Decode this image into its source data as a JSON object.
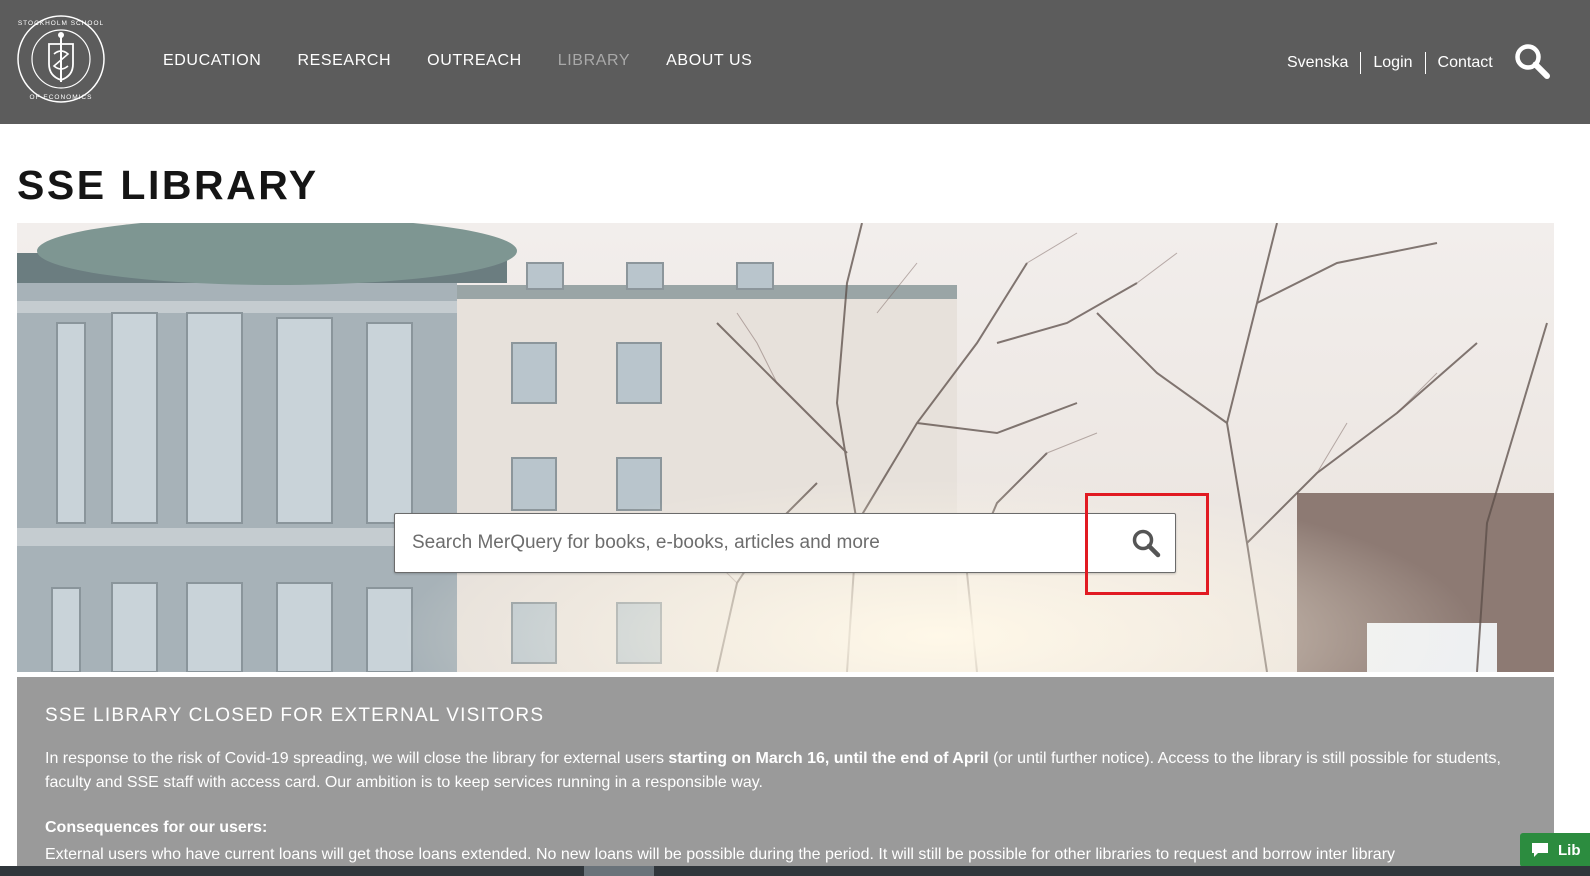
{
  "header": {
    "logo_text": "STOCKHOLM SCHOOL OF ECONOMICS",
    "nav": [
      {
        "label": "EDUCATION",
        "active": false
      },
      {
        "label": "RESEARCH",
        "active": false
      },
      {
        "label": "OUTREACH",
        "active": false
      },
      {
        "label": "LIBRARY",
        "active": true
      },
      {
        "label": "ABOUT US",
        "active": false
      }
    ],
    "utility": [
      "Svenska",
      "Login",
      "Contact"
    ],
    "search_icon": "search-icon"
  },
  "page": {
    "title": "SSE LIBRARY"
  },
  "hero": {
    "search_placeholder": "Search MerQuery for books, e-books, articles and more",
    "search_value": "",
    "search_icon": "search-icon",
    "highlight_color": "#e11a22"
  },
  "notice": {
    "title": "SSE LIBRARY CLOSED FOR EXTERNAL VISITORS",
    "body_pre": "In response to the risk of Covid-19 spreading, we will close the library for external users ",
    "body_bold": "starting on March 16, until the end of April",
    "body_post": " (or until further notice). Access to the library is still possible for students, faculty and SSE staff with access card. Our ambition is to keep services running in a responsible way.",
    "subheading": "Consequences for our users:",
    "body2": "External users who have current loans will get those loans extended. No new loans will be possible during the period. It will still be possible for other libraries to request and borrow inter library"
  },
  "chat": {
    "label": "Lib",
    "icon": "chat-bubble-icon",
    "color": "#2c8c3f"
  },
  "colors": {
    "header_bg": "#5c5c5c",
    "nav_active": "#a9a9a9",
    "notice_bg": "#9a9a9a"
  }
}
